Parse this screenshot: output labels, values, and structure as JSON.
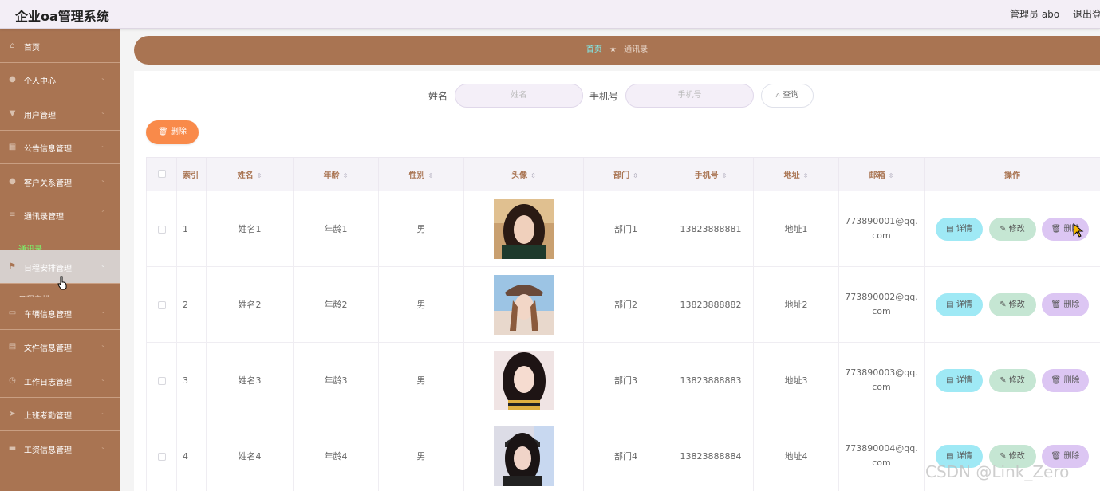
{
  "header": {
    "title": "企业oa管理系统",
    "user_label": "管理员 abo",
    "logout_label": "退出登录"
  },
  "sidebar": {
    "items": [
      {
        "label": "首页",
        "icon": "home-icon"
      },
      {
        "label": "个人中心",
        "icon": "user-icon"
      },
      {
        "label": "用户管理",
        "icon": "users-icon"
      },
      {
        "label": "公告信息管理",
        "icon": "grid-icon"
      },
      {
        "label": "客户关系管理",
        "icon": "contact-icon"
      },
      {
        "label": "通讯录管理",
        "icon": "book-icon"
      },
      {
        "label": "日程安排管理",
        "icon": "flag-icon"
      },
      {
        "label": "车辆信息管理",
        "icon": "chat-icon"
      },
      {
        "label": "文件信息管理",
        "icon": "file-icon"
      },
      {
        "label": "工作日志管理",
        "icon": "clock-icon"
      },
      {
        "label": "上班考勤管理",
        "icon": "send-icon"
      },
      {
        "label": "工资信息管理",
        "icon": "money-icon"
      }
    ],
    "sub_item": "通讯录",
    "hidden_sub": "日程安排"
  },
  "breadcrumb": {
    "home": "首页",
    "separator": "★",
    "current": "通讯录"
  },
  "search": {
    "name_label": "姓名",
    "name_placeholder": "姓名",
    "phone_label": "手机号",
    "phone_placeholder": "手机号",
    "button_label": "查询"
  },
  "toolbar": {
    "delete_label": "删除"
  },
  "table": {
    "columns": [
      "索引",
      "姓名",
      "年龄",
      "性别",
      "头像",
      "部门",
      "手机号",
      "地址",
      "邮箱",
      "操作"
    ],
    "rows": [
      {
        "index": "1",
        "name": "姓名1",
        "age": "年龄1",
        "gender": "男",
        "dept": "部门1",
        "phone": "13823888881",
        "address": "地址1",
        "email": "773890001@qq.com"
      },
      {
        "index": "2",
        "name": "姓名2",
        "age": "年龄2",
        "gender": "男",
        "dept": "部门2",
        "phone": "13823888882",
        "address": "地址2",
        "email": "773890002@qq.com"
      },
      {
        "index": "3",
        "name": "姓名3",
        "age": "年龄3",
        "gender": "男",
        "dept": "部门3",
        "phone": "13823888883",
        "address": "地址3",
        "email": "773890003@qq.com"
      },
      {
        "index": "4",
        "name": "姓名4",
        "age": "年龄4",
        "gender": "男",
        "dept": "部门4",
        "phone": "13823888884",
        "address": "地址4",
        "email": "773890004@qq.com"
      }
    ],
    "actions": {
      "detail": "详情",
      "edit": "修改",
      "remove": "删除"
    }
  },
  "watermark": "CSDN @Link_Zero",
  "colors": {
    "sidebar_bg": "#a97452",
    "header_text": "#a97452",
    "active_submenu": "#7cf56b",
    "delete_button": "#f98a4a",
    "detail_button": "#9fe9f5",
    "edit_button": "#c5e6d3",
    "remove_button": "#dcc6f3"
  }
}
